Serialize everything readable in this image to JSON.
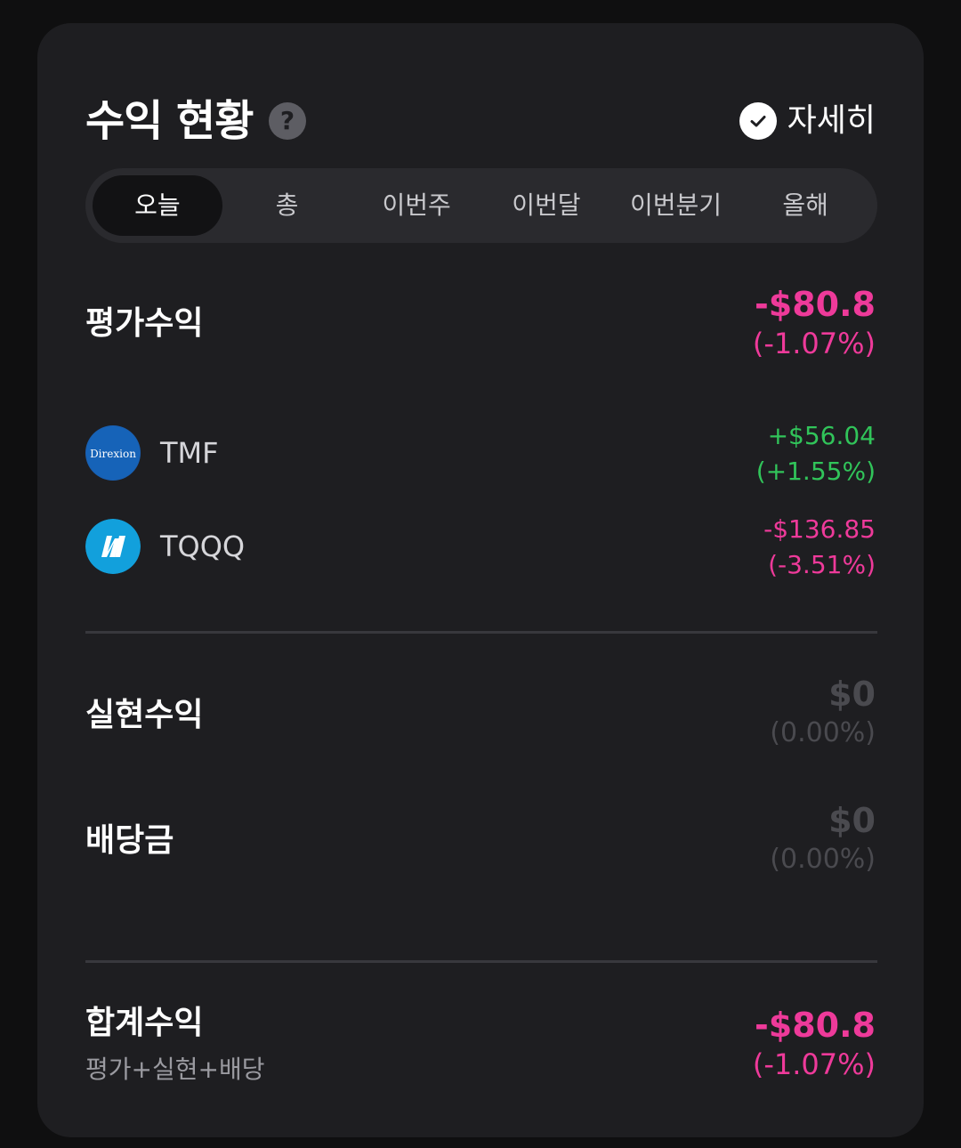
{
  "header": {
    "title": "수익 현황",
    "help_icon": "?",
    "detail_label": "자세히"
  },
  "tabs": [
    {
      "label": "오늘",
      "active": true
    },
    {
      "label": "총",
      "active": false
    },
    {
      "label": "이번주",
      "active": false
    },
    {
      "label": "이번달",
      "active": false
    },
    {
      "label": "이번분기",
      "active": false
    },
    {
      "label": "올해",
      "active": false
    }
  ],
  "evaluation": {
    "label": "평가수익",
    "amount": "-$80.8",
    "percent": "(-1.07%)"
  },
  "holdings": [
    {
      "ticker": "TMF",
      "logo_text": "Direxion",
      "amount": "+$56.04",
      "percent": "(+1.55%)",
      "trend": "up"
    },
    {
      "ticker": "TQQQ",
      "logo_text": "",
      "amount": "-$136.85",
      "percent": "(-3.51%)",
      "trend": "down"
    }
  ],
  "realized": {
    "label": "실현수익",
    "amount": "$0",
    "percent": "(0.00%)"
  },
  "dividend": {
    "label": "배당금",
    "amount": "$0",
    "percent": "(0.00%)"
  },
  "total": {
    "label": "합계수익",
    "sublabel": "평가+실현+배당",
    "amount": "-$80.8",
    "percent": "(-1.07%)"
  },
  "colors": {
    "negative": "#ee3a9a",
    "positive": "#31c45a",
    "card_bg": "#1e1e21",
    "page_bg": "#0f0f10"
  }
}
